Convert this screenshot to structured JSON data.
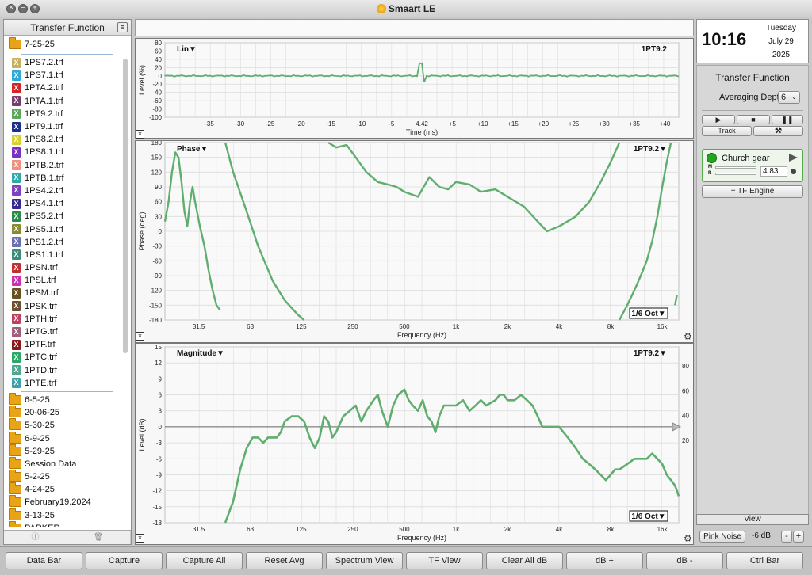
{
  "window": {
    "title": "Smaart LE"
  },
  "left_panel": {
    "title": "Transfer Function",
    "open_folder": "7-25-25",
    "files": [
      {
        "name": "1PS7.2.trf",
        "color": "#c8b060"
      },
      {
        "name": "1PS7.1.trf",
        "color": "#30a8d8"
      },
      {
        "name": "1PTA.2.trf",
        "color": "#d02828"
      },
      {
        "name": "1PTA.1.trf",
        "color": "#7a3c6a"
      },
      {
        "name": "1PT9.2.trf",
        "color": "#5aa858"
      },
      {
        "name": "1PT9.1.trf",
        "color": "#1a2e8a"
      },
      {
        "name": "1PS8.2.trf",
        "color": "#d8d030"
      },
      {
        "name": "1PS8.1.trf",
        "color": "#7a30c0"
      },
      {
        "name": "1PTB.2.trf",
        "color": "#f09080"
      },
      {
        "name": "1PTB.1.trf",
        "color": "#30a8a8"
      },
      {
        "name": "1PS4.2.trf",
        "color": "#8040c0"
      },
      {
        "name": "1PS4.1.trf",
        "color": "#3a2890"
      },
      {
        "name": "1PS5.2.trf",
        "color": "#2a8a4a"
      },
      {
        "name": "1PS5.1.trf",
        "color": "#8a8a30"
      },
      {
        "name": "1PS1.2.trf",
        "color": "#6a70b0"
      },
      {
        "name": "1PS1.1.trf",
        "color": "#408a7a"
      },
      {
        "name": "1PSN.trf",
        "color": "#c03030"
      },
      {
        "name": "1PSL.trf",
        "color": "#d030b0"
      },
      {
        "name": "1PSM.trf",
        "color": "#6a5020"
      },
      {
        "name": "1PSK.trf",
        "color": "#6a5030"
      },
      {
        "name": "1PTH.trf",
        "color": "#c04060"
      },
      {
        "name": "1PTG.trf",
        "color": "#a06080"
      },
      {
        "name": "1PTF.trf",
        "color": "#8a1a1a"
      },
      {
        "name": "1PTC.trf",
        "color": "#2aa868"
      },
      {
        "name": "1PTD.trf",
        "color": "#50a890"
      },
      {
        "name": "1PTE.trf",
        "color": "#40a0a8"
      }
    ],
    "folders": [
      "6-5-25",
      "20-06-25",
      "5-30-25",
      "6-9-25",
      "5-29-25",
      "Session Data",
      "5-2-25",
      "4-24-25",
      "February19.2024",
      "3-13-25",
      "PARKER"
    ]
  },
  "impulse_plot": {
    "mode_label": "Lin▼",
    "trace_label": "1PT9.2",
    "ylabel": "Level (%)",
    "xlabel": "Time (ms)",
    "yticks": [
      "80",
      "60",
      "40",
      "20",
      "0",
      "-20",
      "-40",
      "-60",
      "-80",
      "-100"
    ],
    "xticks": [
      "-35",
      "-30",
      "-25",
      "-20",
      "-15",
      "-10",
      "-5",
      "4.42",
      "+5",
      "+10",
      "+15",
      "+20",
      "+25",
      "+30",
      "+35",
      "+40"
    ]
  },
  "phase_plot": {
    "mode_label": "Phase▼",
    "trace_label": "1PT9.2▼",
    "ylabel": "Phase (deg)",
    "xlabel": "Frequency (Hz)",
    "smoothing": "1/6 Oct▼",
    "yticks": [
      "180",
      "150",
      "120",
      "90",
      "60",
      "30",
      "0",
      "-30",
      "-60",
      "-90",
      "-120",
      "-150",
      "-180"
    ],
    "xticks": [
      "31.5",
      "63",
      "125",
      "250",
      "500",
      "1k",
      "2k",
      "4k",
      "8k",
      "16k"
    ]
  },
  "magnitude_plot": {
    "mode_label": "Magnitude▼",
    "trace_label": "1PT9.2▼",
    "ylabel": "Level (dB)",
    "xlabel": "Frequency (Hz)",
    "smoothing": "1/6 Oct▼",
    "yticks": [
      "15",
      "12",
      "9",
      "6",
      "3",
      "0",
      "-3",
      "-6",
      "-9",
      "-12",
      "-15",
      "-18"
    ],
    "yticks_right": [
      "80",
      "60",
      "40",
      "20"
    ],
    "xticks": [
      "31.5",
      "63",
      "125",
      "250",
      "500",
      "1k",
      "2k",
      "4k",
      "8k",
      "16k"
    ]
  },
  "clock": {
    "time": "10:16",
    "day": "Tuesday",
    "date": "July 29",
    "year": "2025"
  },
  "tf_panel": {
    "title": "Transfer Function",
    "avg_label": "Averaging Depth:",
    "avg_value": "6",
    "track_label": "Track",
    "engine_name": "Church gear",
    "meter_m": "M",
    "meter_r": "R",
    "meter_value": "4.83",
    "add_engine": "+ TF Engine",
    "view_label": "View",
    "pink_noise": "Pink Noise",
    "noise_level": "-6 dB",
    "minus": "-",
    "plus": "+"
  },
  "bottom_buttons": [
    "Data Bar",
    "Capture",
    "Capture All",
    "Reset Avg",
    "Spectrum View",
    "TF View",
    "Clear All dB",
    "dB +",
    "dB -",
    "Ctrl Bar"
  ],
  "colors": {
    "trace": "#5fae6e",
    "grid": "#dcdcdc"
  }
}
